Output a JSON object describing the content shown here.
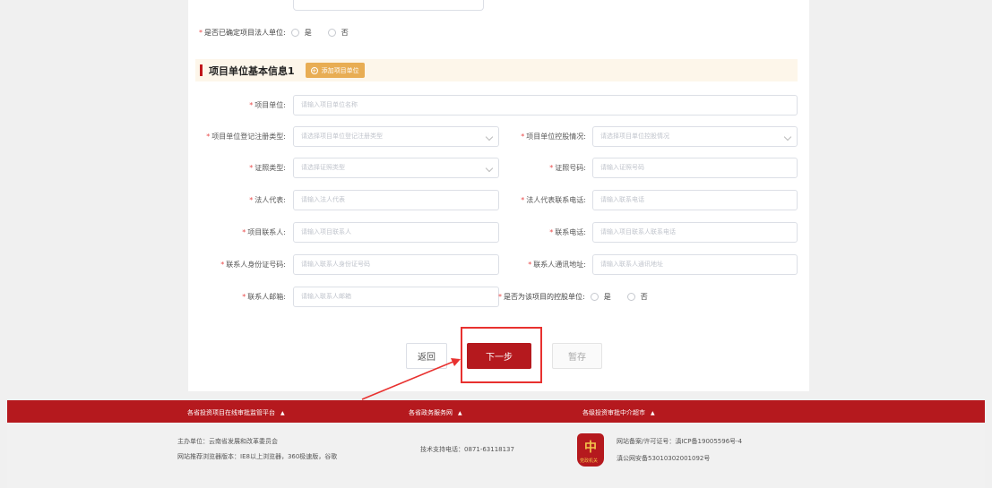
{
  "legal_question": {
    "label": "是否已确定项目法人单位:",
    "options": [
      "是",
      "否"
    ]
  },
  "section": {
    "title": "项目单位基本信息1",
    "add_button": "添加项目单位"
  },
  "fields": {
    "unit": {
      "label": "项目单位:",
      "placeholder": "请输入项目单位名称"
    },
    "reg_type": {
      "label": "项目单位登记注册类型:",
      "placeholder": "请选择项目单位登记注册类型"
    },
    "holding": {
      "label": "项目单位控股情况:",
      "placeholder": "请选择项目单位控股情况"
    },
    "id_type": {
      "label": "证照类型:",
      "placeholder": "请选择证照类型"
    },
    "id_number": {
      "label": "证照号码:",
      "placeholder": "请输入证照号码"
    },
    "legal_rep": {
      "label": "法人代表:",
      "placeholder": "请输入法人代表"
    },
    "legal_phone": {
      "label": "法人代表联系电话:",
      "placeholder": "请输入联系电话"
    },
    "contact": {
      "label": "项目联系人:",
      "placeholder": "请输入项目联系人"
    },
    "contact_phone": {
      "label": "联系电话:",
      "placeholder": "请输入项目联系人联系电话"
    },
    "contact_id": {
      "label": "联系人身份证号码:",
      "placeholder": "请输入联系人身份证号码"
    },
    "contact_address": {
      "label": "联系人通讯地址:",
      "placeholder": "请输入联系人通讯地址"
    },
    "contact_email": {
      "label": "联系人邮箱:",
      "placeholder": "请输入联系人邮箱"
    },
    "is_holding": {
      "label": "是否为该项目的控股单位:",
      "options": [
        "是",
        "否"
      ]
    }
  },
  "buttons": {
    "back": "返回",
    "next": "下一步",
    "save": "暂存"
  },
  "footer": {
    "links": [
      "各省投资项目在线审批监管平台",
      "各省政务服务网",
      "各级投资审批中介超市"
    ],
    "sponsor": "主办单位：云南省发展和改革委员会",
    "browser": "网站推荐浏览器版本：IE8以上浏览器，360极速版，谷歌",
    "support": "技术支持电话：0871-63118137",
    "icp": "网站备案/许可证号：滇ICP备19005596号-4",
    "police": "滇公网安备53010302001092号",
    "logo_text": "党政机关"
  },
  "colors": {
    "brand_red": "#b5191e",
    "highlight": "#e8312f",
    "section_bg": "#fdf6ea",
    "add_button": "#e8ad54"
  }
}
